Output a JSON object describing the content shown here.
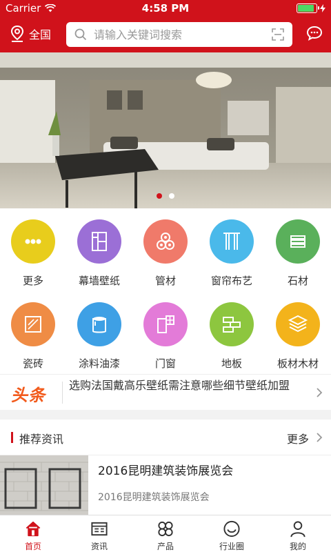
{
  "status_bar": {
    "carrier": "Carrier",
    "time": "4:58 PM",
    "battery_level": 0.9
  },
  "header": {
    "location": "全国",
    "search_placeholder": "请输入关键词搜索"
  },
  "banner": {
    "slide_count": 2,
    "active_slide": 1
  },
  "categories": [
    {
      "label": "更多",
      "color": "#e8cd1c",
      "icon": "more-icon"
    },
    {
      "label": "幕墙壁纸",
      "color": "#9b6fd6",
      "icon": "wallpaper-icon"
    },
    {
      "label": "管材",
      "color": "#f07a6a",
      "icon": "pipe-icon"
    },
    {
      "label": "窗帘布艺",
      "color": "#4ab9ea",
      "icon": "curtain-icon"
    },
    {
      "label": "石材",
      "color": "#5ab05b",
      "icon": "stone-icon"
    },
    {
      "label": "瓷砖",
      "color": "#ef8c45",
      "icon": "tile-icon"
    },
    {
      "label": "涂料油漆",
      "color": "#3ea0e5",
      "icon": "paint-icon"
    },
    {
      "label": "门窗",
      "color": "#e37bd8",
      "icon": "door-window-icon"
    },
    {
      "label": "地板",
      "color": "#8dc63f",
      "icon": "floor-icon"
    },
    {
      "label": "板材木材",
      "color": "#f3b31b",
      "icon": "board-icon"
    }
  ],
  "headline": {
    "tag": "头条",
    "text": "选购法国戴高乐壁纸需注意哪些细节壁纸加盟"
  },
  "section": {
    "title": "推荐资讯",
    "more": "更多"
  },
  "news": [
    {
      "title": "2016昆明建筑装饰展览会",
      "subtitle": "2016昆明建筑装饰展览会"
    }
  ],
  "tabs": [
    {
      "label": "首页",
      "icon": "home-icon",
      "active": true
    },
    {
      "label": "资讯",
      "icon": "news-icon",
      "active": false
    },
    {
      "label": "产品",
      "icon": "product-icon",
      "active": false
    },
    {
      "label": "行业圈",
      "icon": "circle-icon",
      "active": false
    },
    {
      "label": "我的",
      "icon": "user-icon",
      "active": false
    }
  ],
  "colors": {
    "brand": "#d0121b",
    "headline": "#f25a1b"
  }
}
